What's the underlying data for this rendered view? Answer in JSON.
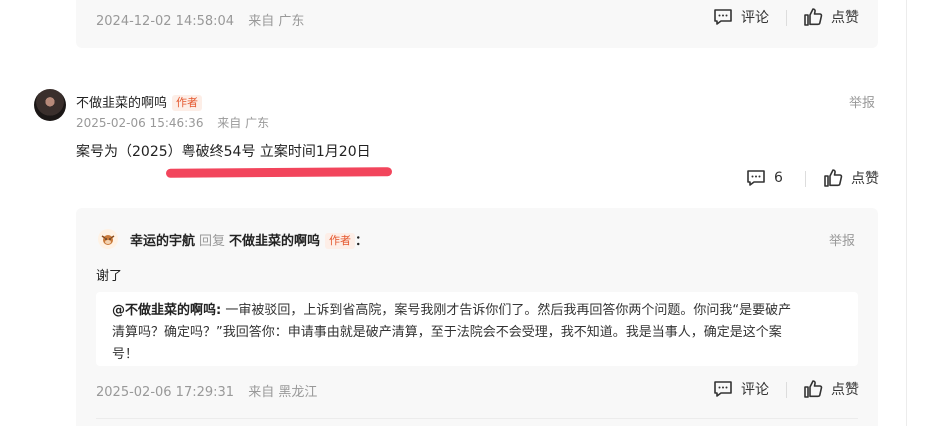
{
  "prev_comment": {
    "timestamp": "2024-12-02 14:58:04",
    "location": "来自 广东",
    "comment_label": "评论",
    "like_label": "点赞"
  },
  "comment": {
    "author": "不做韭菜的啊呜",
    "author_tag": "作者",
    "timestamp": "2025-02-06 15:46:36",
    "location": "来自 广东",
    "text": "案号为（2025）粤破终54号 立案时间1月20日",
    "report_label": "举报",
    "reply_count": "6",
    "like_label": "点赞",
    "highlight_color": "#f2455c"
  },
  "reply": {
    "author": "幸运的宇航",
    "reply_word": "回复",
    "reply_to": "不做韭菜的啊呜",
    "reply_to_tag": "作者",
    "colon": "：",
    "report_label": "举报",
    "text": "谢了",
    "quote_author": "@不做韭菜的啊呜:",
    "quote_line1": "一审被驳回，上诉到省高院，案号我刚才告诉你们了。然后我再回答你两个问题。你问我“是要破产",
    "quote_line2": "清算吗？确定吗？”我回答你：申请事由就是破产清算，至于法院会不会受理，我不知道。我是当事人，确定是这个案",
    "quote_line3": "号！",
    "timestamp": "2025-02-06 17:29:31",
    "location": "来自 黑龙江",
    "comment_label": "评论",
    "like_label": "点赞"
  },
  "colors": {
    "accent_tag": "#e4572e",
    "muted": "#999999"
  }
}
